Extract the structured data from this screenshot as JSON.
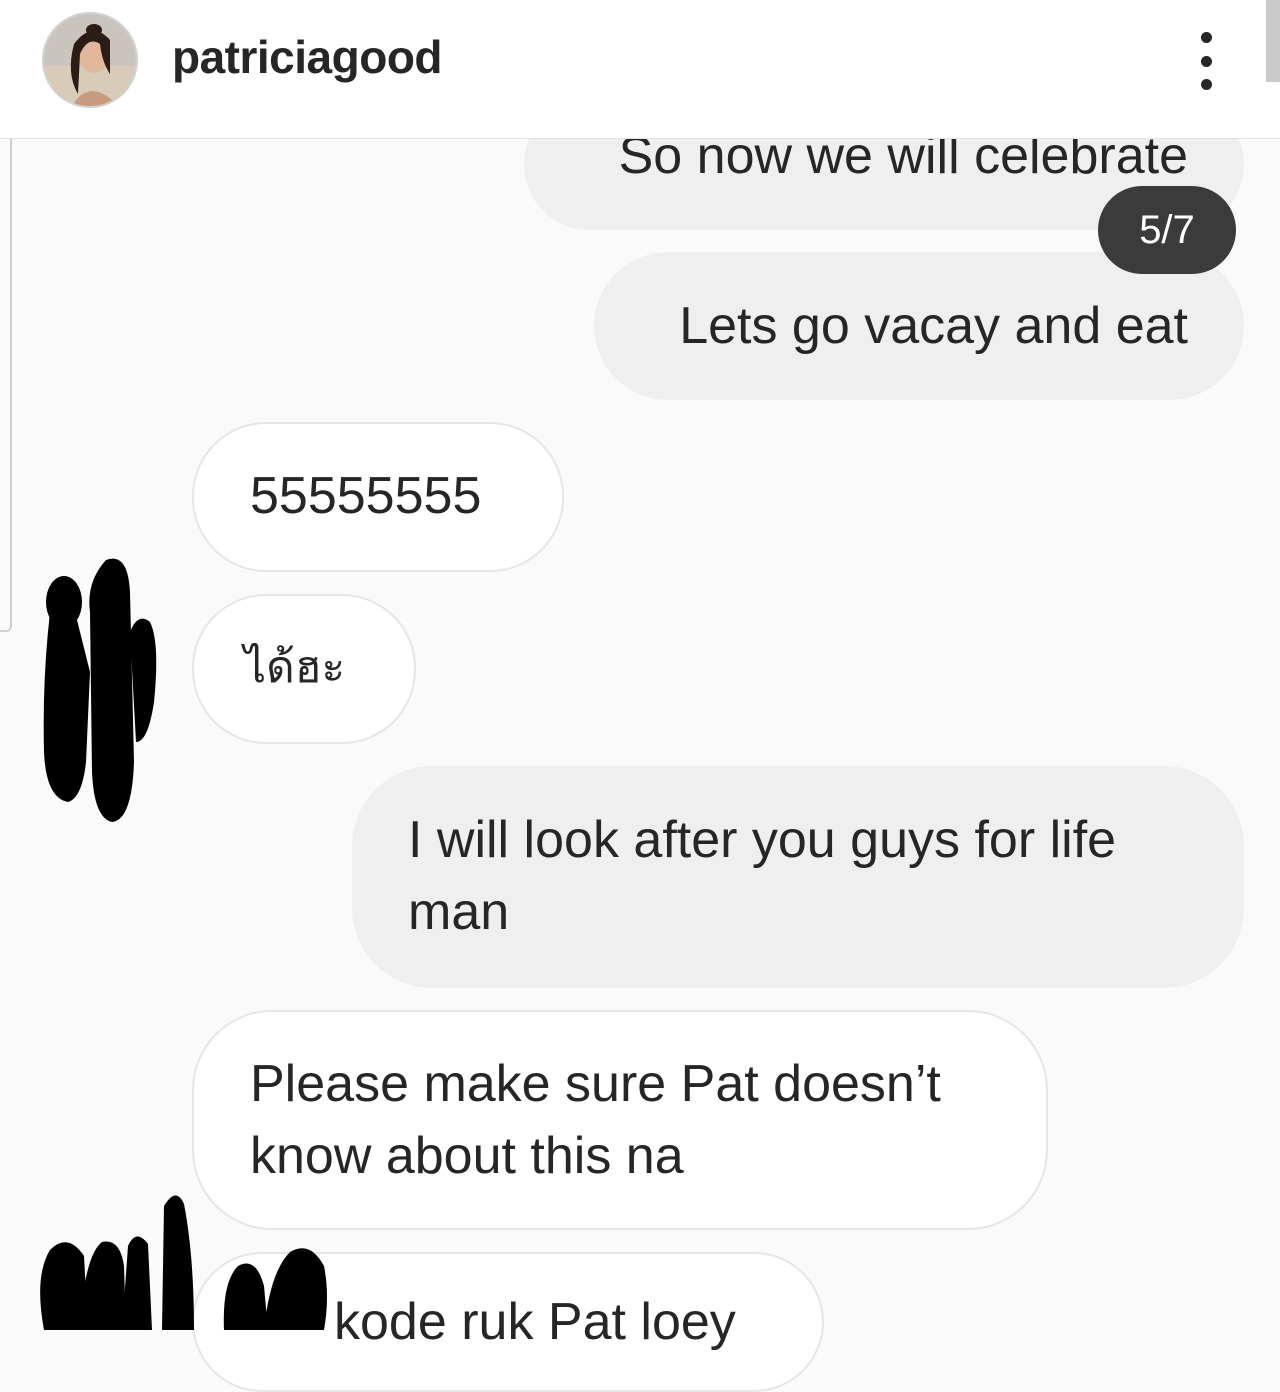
{
  "header": {
    "username": "patriciagood",
    "avatar_icon": "profile-avatar",
    "more_icon": "more-vertical-icon"
  },
  "counter": {
    "text": "5/7"
  },
  "messages": [
    {
      "direction": "outgoing",
      "text": "So now we will celebrate"
    },
    {
      "direction": "outgoing",
      "text": "Lets go vacay and eat"
    },
    {
      "direction": "incoming",
      "text": "55555555"
    },
    {
      "direction": "incoming",
      "text": "ได้ฮะ"
    },
    {
      "direction": "outgoing",
      "text": "I will look after you guys for life man"
    },
    {
      "direction": "incoming",
      "text": "Please make sure Pat doesn’t know about this na"
    },
    {
      "direction": "incoming",
      "text": "kode ruk Pat loey"
    }
  ],
  "colors": {
    "outgoing_bubble": "#efefef",
    "incoming_bubble": "#ffffff",
    "counter_bg": "#3b3b3b",
    "redaction": "#000000"
  }
}
